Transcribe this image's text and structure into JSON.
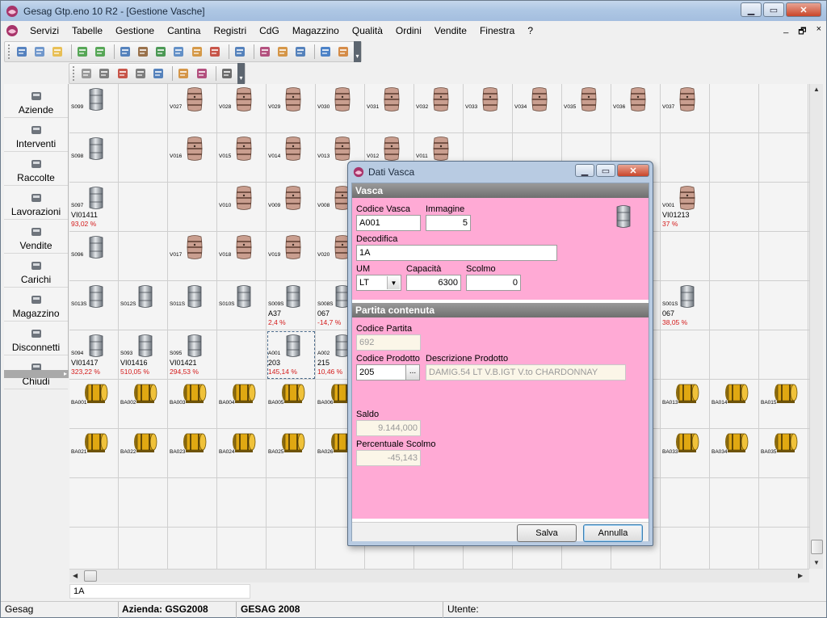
{
  "window": {
    "title": "Gesag Gtp.eno 10 R2 - [Gestione Vasche]",
    "minimize": "▁",
    "maximize": "▭",
    "close": "✕"
  },
  "menubar": {
    "items": [
      {
        "label": "Servizi"
      },
      {
        "label": "Tabelle"
      },
      {
        "label": "Gestione"
      },
      {
        "label": "Cantina"
      },
      {
        "label": "Registri"
      },
      {
        "label": "CdG"
      },
      {
        "label": "Magazzino"
      },
      {
        "label": "Qualità"
      },
      {
        "label": "Ordini"
      },
      {
        "label": "Vendite"
      },
      {
        "label": "Finestra"
      },
      {
        "label": "?"
      }
    ],
    "mdi_minimize": "_",
    "mdi_restore": "🗗",
    "mdi_close": "×"
  },
  "toolbar1": {
    "icons": [
      "home-icon",
      "copy-windows-icon",
      "folder-icon",
      "green-circle-back-icon",
      "green-circle-forward-icon",
      "bar-chart-icon",
      "box-icon",
      "green-box-icon",
      "export-icon",
      "report-a-icon",
      "report-b-icon",
      "network-icon",
      "wine-glass-icon",
      "truck-icon",
      "calendar-icon",
      "info-icon",
      "user-icon"
    ],
    "dropdown": "▾"
  },
  "toolbar2": {
    "icons": [
      "copy-icon",
      "edit-icon",
      "delete-icon",
      "move-icon",
      "refresh-icon",
      "transfer-icon",
      "merge-icon",
      "print-icon"
    ],
    "dropdown": "▾"
  },
  "sidebar": {
    "items": [
      {
        "label": "Aziende",
        "icon": "gear-icon"
      },
      {
        "label": "Interventi",
        "icon": "hand-icon"
      },
      {
        "label": "Raccolte",
        "icon": "tractor-icon"
      },
      {
        "label": "Lavorazioni",
        "icon": "machine-icon"
      },
      {
        "label": "Vendite",
        "icon": "cash-register-icon"
      },
      {
        "label": "Carichi",
        "icon": "truck-icon"
      },
      {
        "label": "Magazzino",
        "icon": "warehouse-icon"
      },
      {
        "label": "Disconnetti",
        "icon": "keys-icon"
      },
      {
        "label": "Chiudi",
        "icon": "door-icon"
      }
    ],
    "collapse": "▸"
  },
  "colors": {
    "pink_panel": "#ffaad5",
    "alert_red": "#d41a1a",
    "barrel_wood": "#c99e8f",
    "steel_tank": "#9ea5ad",
    "barrique_gold": "#e0a812"
  },
  "grid": {
    "rows": [
      [
        {
          "type": "steel",
          "code": "S099"
        },
        null,
        {
          "type": "wood",
          "code": "V027"
        },
        {
          "type": "wood",
          "code": "V028"
        },
        {
          "type": "wood",
          "code": "V029"
        },
        {
          "type": "wood",
          "code": "V030"
        },
        {
          "type": "wood",
          "code": "V031"
        },
        {
          "type": "wood",
          "code": "V032"
        },
        {
          "type": "wood",
          "code": "V033"
        },
        {
          "type": "wood",
          "code": "V034"
        },
        {
          "type": "wood",
          "code": "V035"
        },
        {
          "type": "wood",
          "code": "V036"
        },
        {
          "type": "wood",
          "code": "V037"
        },
        null,
        null
      ],
      [
        {
          "type": "steel",
          "code": "S098"
        },
        null,
        {
          "type": "wood",
          "code": "V016"
        },
        {
          "type": "wood",
          "code": "V015"
        },
        {
          "type": "wood",
          "code": "V014"
        },
        {
          "type": "wood",
          "code": "V013"
        },
        {
          "type": "wood",
          "code": "V012"
        },
        {
          "type": "wood",
          "code": "V011"
        },
        null,
        null,
        null,
        null,
        null,
        null,
        null
      ],
      [
        {
          "type": "steel",
          "code": "S097",
          "l1": "VI01411",
          "l2": "93,02 %"
        },
        null,
        null,
        {
          "type": "wood",
          "code": "V010"
        },
        {
          "type": "wood",
          "code": "V009"
        },
        {
          "type": "wood",
          "code": "V008"
        },
        null,
        null,
        null,
        null,
        null,
        null,
        {
          "type": "wood",
          "code": "V001",
          "l1": "VI01213",
          "l2": "37 %"
        },
        null,
        null
      ],
      [
        {
          "type": "steel",
          "code": "S096"
        },
        null,
        {
          "type": "wood",
          "code": "V017"
        },
        {
          "type": "wood",
          "code": "V018"
        },
        {
          "type": "wood",
          "code": "V019"
        },
        {
          "type": "wood",
          "code": "V020"
        },
        null,
        null,
        null,
        null,
        null,
        null,
        null,
        null,
        null
      ],
      [
        {
          "type": "steel",
          "code": "S013S"
        },
        {
          "type": "steel",
          "code": "S012S"
        },
        {
          "type": "steel",
          "code": "S011S"
        },
        {
          "type": "steel",
          "code": "S010S"
        },
        {
          "type": "steel",
          "code": "S009S",
          "l1": "A37",
          "l2": "2,4 %"
        },
        {
          "type": "steel",
          "code": "S008S",
          "l1": "067",
          "l2": "-14,7 %"
        },
        null,
        null,
        null,
        null,
        null,
        null,
        {
          "type": "steel",
          "code": "S001S",
          "l1": "067",
          "l2": "38,05 %"
        },
        null,
        null
      ],
      [
        {
          "type": "steel",
          "code": "S094",
          "l1": "VI01417",
          "l2": "323,22 %"
        },
        {
          "type": "steel",
          "code": "S093",
          "l1": "VI01416",
          "l2": "510,05 %"
        },
        {
          "type": "steel",
          "code": "S095",
          "l1": "VI01421",
          "l2": "294,53 %"
        },
        null,
        {
          "type": "steel",
          "code": "A001",
          "l1": "203",
          "l2": "145,14 %",
          "selected": true
        },
        {
          "type": "steel",
          "code": "A002",
          "l1": "215",
          "l2": "10,46 %"
        },
        null,
        null,
        null,
        null,
        null,
        null,
        null,
        null,
        null
      ],
      [
        {
          "type": "barrique",
          "code": "BA001"
        },
        {
          "type": "barrique",
          "code": "BA002"
        },
        {
          "type": "barrique",
          "code": "BA003"
        },
        {
          "type": "barrique",
          "code": "BA004"
        },
        {
          "type": "barrique",
          "code": "BA005"
        },
        {
          "type": "barrique",
          "code": "BA006"
        },
        null,
        null,
        null,
        null,
        null,
        null,
        {
          "type": "barrique",
          "code": "BA013"
        },
        {
          "type": "barrique",
          "code": "BA014"
        },
        {
          "type": "barrique",
          "code": "BA015"
        }
      ],
      [
        {
          "type": "barrique",
          "code": "BA021"
        },
        {
          "type": "barrique",
          "code": "BA022"
        },
        {
          "type": "barrique",
          "code": "BA023"
        },
        {
          "type": "barrique",
          "code": "BA024"
        },
        {
          "type": "barrique",
          "code": "BA025"
        },
        {
          "type": "barrique",
          "code": "BA026"
        },
        null,
        null,
        null,
        null,
        null,
        null,
        {
          "type": "barrique",
          "code": "BA033"
        },
        {
          "type": "barrique",
          "code": "BA034"
        },
        {
          "type": "barrique",
          "code": "BA035"
        }
      ],
      [
        null,
        null,
        null,
        null,
        null,
        null,
        null,
        null,
        null,
        null,
        null,
        null,
        null,
        null,
        null
      ]
    ]
  },
  "cell_field": {
    "value": "1A"
  },
  "statusbar": {
    "app": "Gesag",
    "azienda": "Azienda: GSG2008",
    "db": "GESAG 2008",
    "utente": "Utente:"
  },
  "dialog": {
    "title": "Dati Vasca",
    "section_vasca": "Vasca",
    "codice_vasca": {
      "label": "Codice Vasca",
      "value": "A001"
    },
    "immagine": {
      "label": "Immagine",
      "value": "5"
    },
    "decodifica": {
      "label": "Decodifica",
      "value": "1A"
    },
    "um": {
      "label": "UM",
      "value": "LT"
    },
    "capacita": {
      "label": "Capacità",
      "value": "6300"
    },
    "scolmo": {
      "label": "Scolmo",
      "value": "0"
    },
    "section_partita": "Partita contenuta",
    "codice_partita": {
      "label": "Codice Partita",
      "value": "692"
    },
    "codice_prodotto": {
      "label": "Codice Prodotto",
      "value": "205",
      "ellipsis": "..."
    },
    "descrizione_prodotto": {
      "label": "Descrizione Prodotto",
      "value": "DAMIG.54 LT V.B.IGT V.to CHARDONNAY"
    },
    "saldo": {
      "label": "Saldo",
      "value": "9.144,000"
    },
    "percentuale_scolmo": {
      "label": "Percentuale Scolmo",
      "value": "-45,143"
    },
    "btn_salva": "Salva",
    "btn_annulla": "Annulla"
  }
}
